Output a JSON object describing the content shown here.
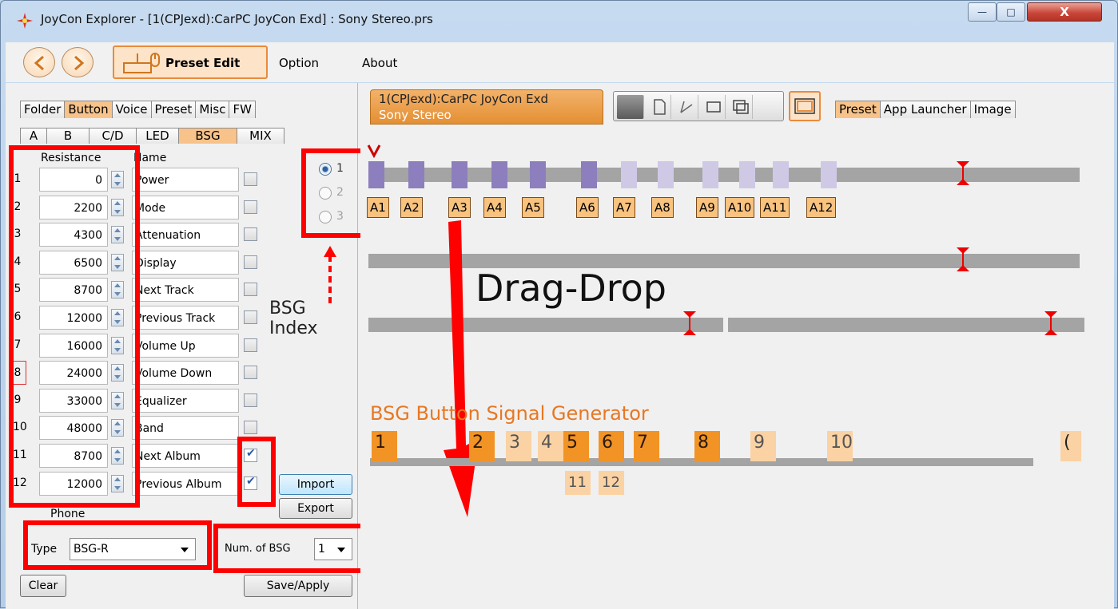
{
  "window": {
    "title": "JoyCon Explorer - [1(CPJexd):CarPC JoyCon Exd] : Sony Stereo.prs",
    "controls": {
      "minimize": "—",
      "maximize": "□",
      "close": "X"
    }
  },
  "menubar": {
    "preset_edit": "Preset Edit",
    "option": "Option",
    "about": "About"
  },
  "left": {
    "tabs_main": [
      "Folder",
      "Button",
      "Voice",
      "Preset",
      "Misc",
      "FW"
    ],
    "tabs_main_active": "Button",
    "tabs_sub": [
      "A",
      "B",
      "C/D",
      "LED",
      "BSG",
      "MIX"
    ],
    "tabs_sub_active": "BSG",
    "header_resistance": "Resistance",
    "header_name": "Name",
    "rows": [
      {
        "idx": "1",
        "resistance": "0",
        "name": "Power",
        "checked": false
      },
      {
        "idx": "2",
        "resistance": "2200",
        "name": "Mode",
        "checked": false
      },
      {
        "idx": "3",
        "resistance": "4300",
        "name": "Attenuation",
        "checked": false
      },
      {
        "idx": "4",
        "resistance": "6500",
        "name": "Display",
        "checked": false
      },
      {
        "idx": "5",
        "resistance": "8700",
        "name": "Next Track",
        "checked": false
      },
      {
        "idx": "6",
        "resistance": "12000",
        "name": "Previous Track",
        "checked": false
      },
      {
        "idx": "7",
        "resistance": "16000",
        "name": "Volume Up",
        "checked": false
      },
      {
        "idx": "8",
        "resistance": "24000",
        "name": "Volume Down",
        "checked": false
      },
      {
        "idx": "9",
        "resistance": "33000",
        "name": "Equalizer",
        "checked": false
      },
      {
        "idx": "10",
        "resistance": "48000",
        "name": "Band",
        "checked": false
      },
      {
        "idx": "11",
        "resistance": "8700",
        "name": "Next Album",
        "checked": true
      },
      {
        "idx": "12",
        "resistance": "12000",
        "name": "Previous Album",
        "checked": true
      }
    ],
    "bsg_index_options": [
      "1",
      "2",
      "3"
    ],
    "bsg_index_selected": "1",
    "bsg_index_annotation": "BSG Index",
    "import_label": "Import",
    "export_label": "Export",
    "phone_label": "Phone",
    "type_label": "Type",
    "type_value": "BSG-R",
    "num_bsg_label": "Num. of BSG",
    "num_bsg_value": "1",
    "clear_label": "Clear",
    "save_apply_label": "Save/Apply"
  },
  "right": {
    "preset_tab_line1": "1(CPJexd):CarPC JoyCon Exd",
    "preset_tab_line2": "Sony Stereo",
    "tabs": [
      "Preset",
      "App Launcher",
      "Image"
    ],
    "tabs_active": "Preset",
    "track1_labels": [
      "A1",
      "A2",
      "A3",
      "A4",
      "A5",
      "A6",
      "A7",
      "A8",
      "A9",
      "A10",
      "A11",
      "A12"
    ],
    "drag_drop_annotation": "Drag-Drop",
    "bsg_title": "BSG Button Signal Generator",
    "bsg_buttons": [
      "1",
      "2",
      "3",
      "4",
      "5",
      "6",
      "7",
      "8",
      "9",
      "10"
    ],
    "bsg_buttons_lower": [
      "11",
      "12"
    ]
  },
  "colors": {
    "highlight_red": "#ff0000",
    "accent_orange": "#f29325",
    "slot_purple": "#8d7fbd",
    "bsg_title": "#e87722"
  }
}
